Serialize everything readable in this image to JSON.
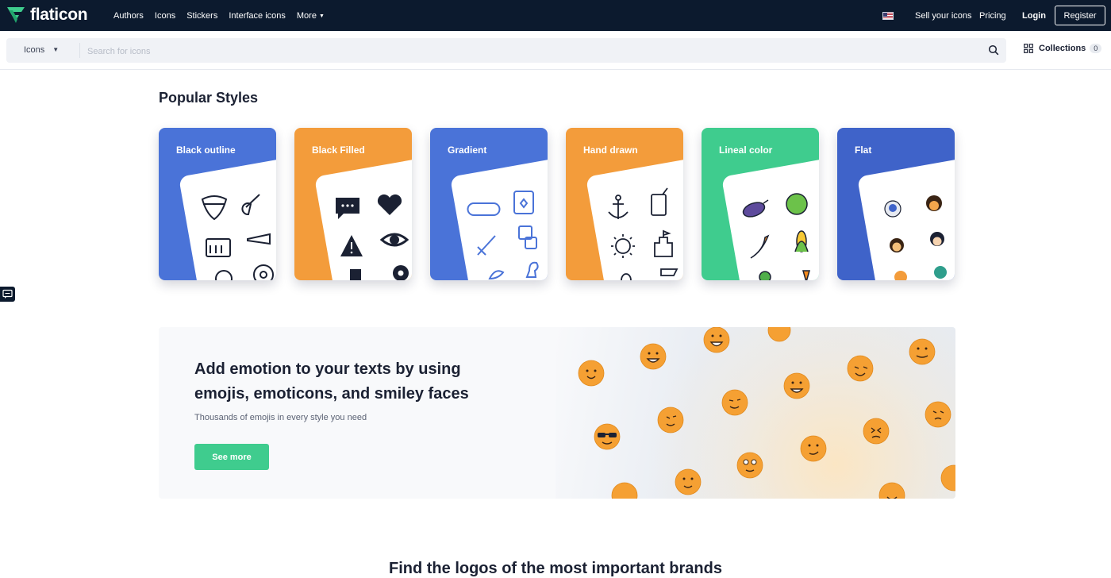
{
  "brand": {
    "name": "flaticon",
    "logo": "flaticon-logo"
  },
  "nav": {
    "links": [
      "Authors",
      "Icons",
      "Stickers",
      "Interface icons",
      "More"
    ],
    "sell": "Sell your icons",
    "pricing": "Pricing",
    "login": "Login",
    "register": "Register",
    "flag": "us-flag-icon"
  },
  "search": {
    "type": "Icons",
    "placeholder": "Search for icons"
  },
  "collections": {
    "label": "Collections",
    "count": "0"
  },
  "styles": {
    "title": "Popular Styles",
    "cards": [
      {
        "label": "Black outline",
        "color": "#4a73d8"
      },
      {
        "label": "Black Filled",
        "color": "#f39c3b"
      },
      {
        "label": "Gradient",
        "color": "#4a73d8"
      },
      {
        "label": "Hand drawn",
        "color": "#f39c3b"
      },
      {
        "label": "Lineal color",
        "color": "#3fcc8e"
      },
      {
        "label": "Flat",
        "color": "#3f63c9"
      }
    ]
  },
  "banner": {
    "title": "Add emotion to your texts by using emojis, emoticons, and smiley faces",
    "subtitle": "Thousands of emojis in every style you need",
    "button": "See more"
  },
  "bottom": {
    "heading": "Find the logos of the most important brands"
  },
  "colors": {
    "nav_bg": "#0c1a2e",
    "accent_green": "#3fcc8e",
    "emoji": "#f5a033"
  }
}
